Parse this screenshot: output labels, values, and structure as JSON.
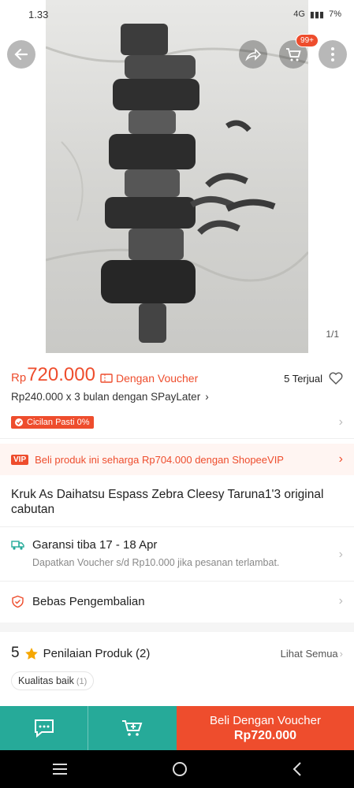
{
  "status": {
    "time": "1.33",
    "network": "4G",
    "battery": "7%"
  },
  "gallery": {
    "counter": "1/1",
    "cart_badge": "99+"
  },
  "price": {
    "currency": "Rp",
    "amount": "720.000",
    "voucher_label": "Dengan Voucher",
    "sold": "5 Terjual",
    "installment": "Rp240.000 x 3 bulan dengan SPayLater"
  },
  "cicilan": {
    "label": "Cicilan Pasti 0%"
  },
  "vip": {
    "tag": "VIP",
    "text": "Beli produk ini seharga Rp704.000 dengan ShopeeVIP"
  },
  "product": {
    "title": "Kruk As Daihatsu Espass Zebra Cleesy Taruna1'3 original cabutan"
  },
  "shipping": {
    "title": "Garansi tiba 17 - 18 Apr",
    "subtitle": "Dapatkan Voucher s/d Rp10.000 jika pesanan terlambat."
  },
  "returns": {
    "label": "Bebas Pengembalian"
  },
  "rating": {
    "score": "5",
    "label": "Penilaian Produk",
    "count": "(2)",
    "see_all": "Lihat Semua"
  },
  "review_chip": {
    "label": "Kualitas baik",
    "count": "(1)"
  },
  "actions": {
    "buy_line1": "Beli Dengan Voucher",
    "buy_line2": "Rp720.000"
  },
  "colors": {
    "accent": "#ee4d2d",
    "teal": "#26aa99"
  }
}
